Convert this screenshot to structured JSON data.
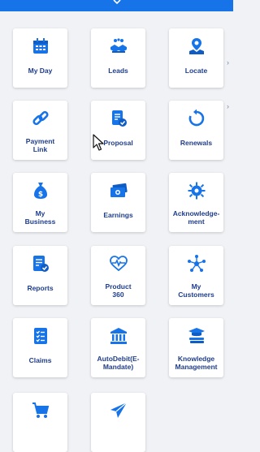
{
  "header": {
    "chevron_icon": "chevron-down-icon",
    "color": "#1673e8"
  },
  "accent": "#1673e8",
  "label_color": "#1f3d8a",
  "tiles": [
    {
      "label": "My Day",
      "icon": "calendar-icon"
    },
    {
      "label": "Leads",
      "icon": "handshake-icon"
    },
    {
      "label": "Locate",
      "icon": "map-pin-icon"
    },
    {
      "label": "Payment\nLink",
      "icon": "link-icon"
    },
    {
      "label": "Proposal",
      "icon": "document-check-icon"
    },
    {
      "label": "Renewals",
      "icon": "refresh-icon"
    },
    {
      "label": "My\nBusiness",
      "icon": "money-bag-icon"
    },
    {
      "label": "Earnings",
      "icon": "cash-icon"
    },
    {
      "label": "Acknowledge-\nment",
      "icon": "settings-badge-icon"
    },
    {
      "label": "Reports",
      "icon": "report-check-icon"
    },
    {
      "label": "Product\n360",
      "icon": "heart-pulse-icon"
    },
    {
      "label": "My\nCustomers",
      "icon": "network-icon"
    },
    {
      "label": "Claims",
      "icon": "checklist-icon"
    },
    {
      "label": "AutoDebit(E-\nMandate)",
      "icon": "bank-icon"
    },
    {
      "label": "Knowledge\nManagement",
      "icon": "books-icon"
    },
    {
      "label": "",
      "icon": "cart-icon"
    },
    {
      "label": "",
      "icon": "paper-plane-icon"
    }
  ]
}
